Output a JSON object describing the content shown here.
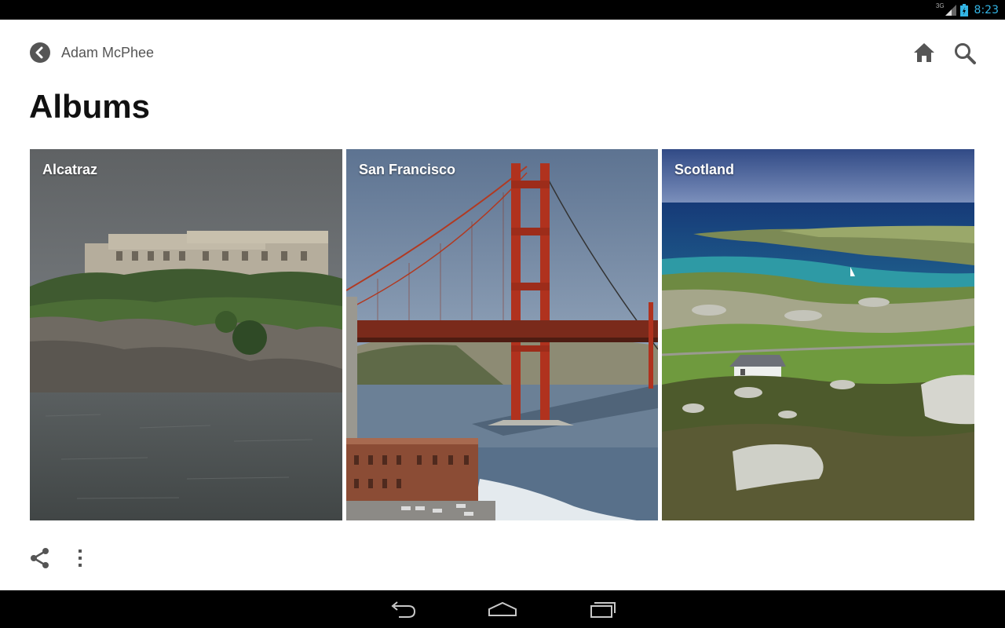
{
  "status_bar": {
    "network_type": "3G",
    "time": "8:23",
    "time_color": "#33b5e5",
    "icons": [
      "signal-icon",
      "battery-icon"
    ]
  },
  "header": {
    "back_icon": "back-arrow-icon",
    "owner_name": "Adam McPhee",
    "home_icon": "home-icon",
    "search_icon": "search-icon"
  },
  "page": {
    "title": "Albums"
  },
  "albums": [
    {
      "name": "Alcatraz"
    },
    {
      "name": "San Francisco"
    },
    {
      "name": "Scotland"
    }
  ],
  "actions": {
    "share_icon": "share-icon",
    "overflow_icon": "overflow-menu-icon"
  },
  "nav_bar": {
    "icons": [
      "nav-back-icon",
      "nav-home-icon",
      "nav-recents-icon"
    ]
  }
}
